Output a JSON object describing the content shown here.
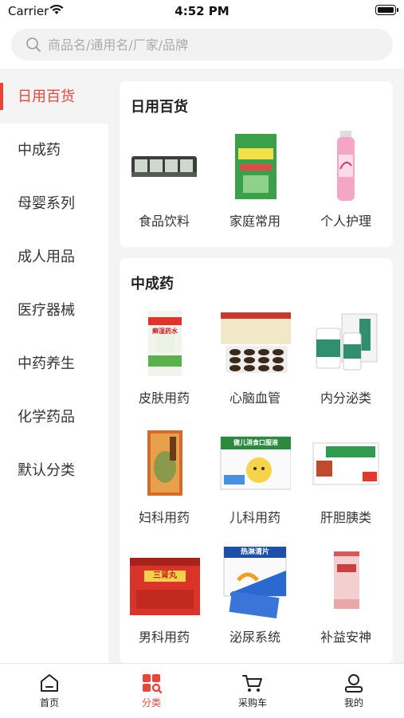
{
  "status": {
    "carrier": "Carrier",
    "time": "4:52 PM"
  },
  "search": {
    "placeholder": "商品名/通用名/厂家/品牌"
  },
  "sidebar": {
    "items": [
      {
        "label": "日用百货",
        "active": true
      },
      {
        "label": "中成药",
        "active": false
      },
      {
        "label": "母婴系列",
        "active": false
      },
      {
        "label": "成人用品",
        "active": false
      },
      {
        "label": "医疗器械",
        "active": false
      },
      {
        "label": "中药养生",
        "active": false
      },
      {
        "label": "化学药品",
        "active": false
      },
      {
        "label": "默认分类",
        "active": false
      }
    ]
  },
  "sections": [
    {
      "title": "日用百货",
      "items": [
        {
          "label": "食品饮料",
          "icon": "food-package-image"
        },
        {
          "label": "家庭常用",
          "icon": "green-box-image"
        },
        {
          "label": "个人护理",
          "icon": "pink-bottle-image"
        }
      ]
    },
    {
      "title": "中成药",
      "items": [
        {
          "label": "皮肤用药",
          "icon": "medicine-box-image",
          "box_text": "癣湿药水"
        },
        {
          "label": "心脑血管",
          "icon": "pill-blister-image"
        },
        {
          "label": "内分泌类",
          "icon": "pill-bottles-image"
        },
        {
          "label": "妇科用药",
          "icon": "orange-box-image"
        },
        {
          "label": "儿科用药",
          "icon": "kids-medicine-image",
          "box_text": "健儿消食口服液"
        },
        {
          "label": "肝胆胰类",
          "icon": "capsule-box-image"
        },
        {
          "label": "男科用药",
          "icon": "red-box-image",
          "box_text": "三肾丸"
        },
        {
          "label": "泌尿系统",
          "icon": "blue-box-image",
          "box_text": "热淋清片"
        },
        {
          "label": "补益安神",
          "icon": "pink-box-image"
        }
      ]
    }
  ],
  "tabs": [
    {
      "label": "首页",
      "icon": "home-icon",
      "active": false
    },
    {
      "label": "分类",
      "icon": "category-icon",
      "active": true
    },
    {
      "label": "采购车",
      "icon": "cart-icon",
      "active": false
    },
    {
      "label": "我的",
      "icon": "user-icon",
      "active": false
    }
  ],
  "colors": {
    "accent": "#e8463a",
    "background": "#f4f4f4"
  }
}
